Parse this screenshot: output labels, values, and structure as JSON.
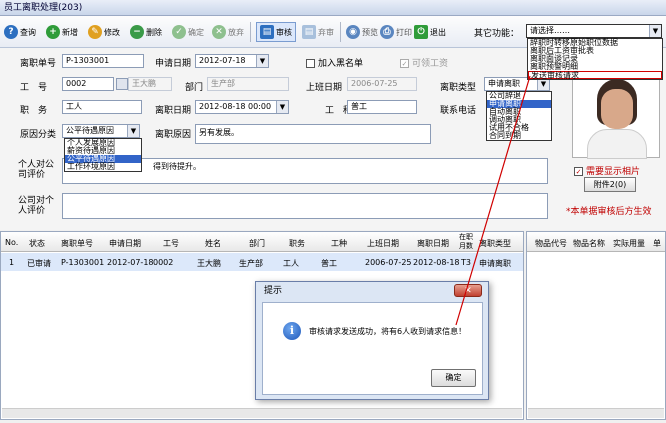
{
  "window": {
    "title": "员工离职处理(203)"
  },
  "toolbar": {
    "query": "查询",
    "add": "新增",
    "edit": "修改",
    "delete": "删除",
    "confirm": "确定",
    "abandon": "放弃",
    "submit": "审核",
    "reverse_audit": "弃审",
    "preview": "预览",
    "print": "打印",
    "exit": "退出",
    "other_label": "其它功能",
    "other_value": "请选择……"
  },
  "other_menu": [
    "辞职时转移原始职位数据",
    "离职后工资审批表",
    "离职面谈记录",
    "离职预警明细",
    "发送审核请求"
  ],
  "form": {
    "doc_no_label": "离职单号",
    "doc_no": "P-1303001",
    "apply_date_label": "申请日期",
    "apply_date": "2012-07-18",
    "blacklist_label": "加入黑名单",
    "recall_label": "可领工资",
    "emp_no_label": "工　号",
    "emp_no": "0002",
    "emp_name": "王大鹏",
    "dept_label": "部门",
    "dept": "生产部",
    "hire_date_label": "上班日期",
    "hire_date": "2006-07-25",
    "leave_type_label": "离职类型",
    "leave_type": "申请离职",
    "position_label": "职　务",
    "position": "工人",
    "leave_date_label": "离职日期",
    "leave_date": "2012-08-18 00:00",
    "job_label": "工　种",
    "job": "普工",
    "contact_label": "联系电话",
    "reason_cat_label": "原因分类",
    "reason_cat": "公平待遇原因",
    "reason_label": "离职原因",
    "reason": "另有发展。",
    "personal_comment_label": "个人对公司评价",
    "personal_comment": "得到待提升。",
    "company_comment_label": "公司对个人评价",
    "show_photo_label": "需要显示相片",
    "attachment_label": "附件2(0)",
    "note": "*本单据审核后方生效"
  },
  "leave_type_options": [
    "公司辞退",
    "申请离职",
    "自动离职",
    "调动离职",
    "试用不合格",
    "合同到期"
  ],
  "reason_options": [
    "个人发展原因",
    "薪资待遇原因",
    "公平待遇原因",
    "工作环境原因"
  ],
  "grid": {
    "headers": [
      "No.",
      "状态",
      "离职单号",
      "申请日期",
      "工号",
      "姓名",
      "部门",
      "职务",
      "工种",
      "上班日期",
      "离职日期",
      "在职月数",
      "离职类型"
    ],
    "rows": [
      [
        "1",
        "已审请",
        "P-1303001",
        "2012-07-18",
        "0002",
        "王大鹏",
        "生产部",
        "工人",
        "普工",
        "2006-07-25",
        "2012-08-18",
        "T3",
        "申请离职"
      ]
    ]
  },
  "grid2": {
    "headers": [
      "物品代号",
      "物品名称",
      "实际用量",
      "单"
    ]
  },
  "dialog": {
    "title": "提示",
    "message": "审核请求发送成功，将有6人收到请求信息！",
    "ok": "确定"
  }
}
